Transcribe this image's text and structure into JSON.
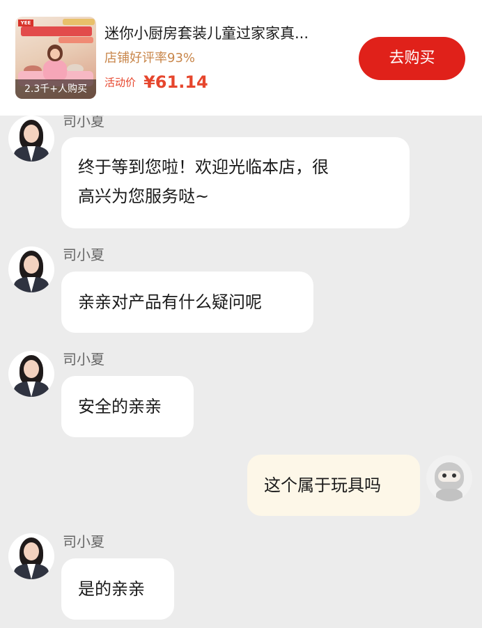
{
  "product": {
    "title": "迷你小厨房套装儿童过家家真...",
    "rating_text": "店铺好评率93%",
    "price_label": "活动价",
    "price_value": "¥61.14",
    "buyers_text": "2.3千+人购买",
    "buy_button_label": "去购买",
    "thumb_brand": "YEE",
    "accent_color": "#e0211a"
  },
  "chat": {
    "agent_name": "司小夏",
    "messages": [
      {
        "from": "agent",
        "sender": "司小夏",
        "text_lines": [
          "终于等到您啦！欢迎光临本店，很",
          "高兴为您服务哒~"
        ]
      },
      {
        "from": "agent",
        "sender": "司小夏",
        "text": "亲亲对产品有什么疑问呢"
      },
      {
        "from": "agent",
        "sender": "司小夏",
        "text": "安全的亲亲"
      },
      {
        "from": "user",
        "text": "这个属于玩具吗"
      },
      {
        "from": "agent",
        "sender": "司小夏",
        "text": "是的亲亲"
      }
    ]
  }
}
